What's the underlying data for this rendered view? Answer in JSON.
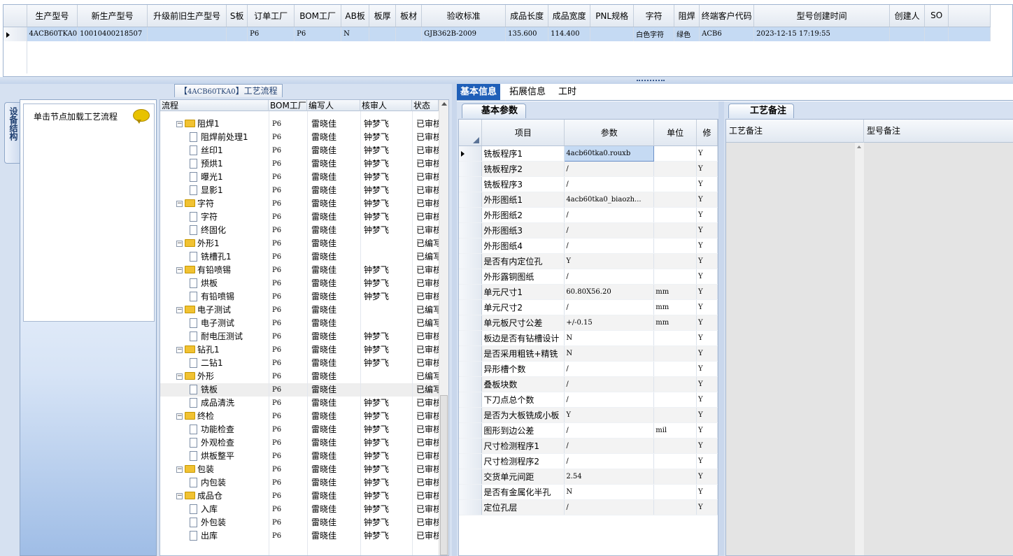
{
  "top_grid": {
    "columns": [
      "生产型号",
      "新生产型号",
      "升级前旧生产型号",
      "S板",
      "订单工厂",
      "BOM工厂",
      "AB板",
      "板厚",
      "板材",
      "验收标准",
      "成品长度",
      "成品宽度",
      "PNL规格",
      "字符",
      "阻焊",
      "终端客户代码",
      "型号创建时间",
      "创建人",
      "SO"
    ],
    "row": [
      "4ACB60TKA0",
      "10010400218507",
      "",
      "",
      "P6",
      "P6",
      "N",
      "",
      "",
      "GJB362B-2009",
      "135.600",
      "114.400",
      "",
      "白色字符",
      "绿色",
      "ACB6",
      "2023-12-15 17:19:55",
      "",
      ""
    ]
  },
  "side_tab": {
    "label": "设备结构"
  },
  "nav": {
    "hint": "单击节点加载工艺流程"
  },
  "process": {
    "title_prefix": "【",
    "title_code": "4ACB60TKA0",
    "title_suffix": "】工艺流程",
    "columns": [
      "流程",
      "BOM工厂",
      "编写人",
      "核审人",
      "状态"
    ],
    "rows": [
      {
        "level": 1,
        "type": "folder",
        "name": "阻焊1",
        "bom": "P6",
        "writer": "雷晓佳",
        "reviewer": "钟梦飞",
        "status": "已审核"
      },
      {
        "level": 2,
        "type": "doc",
        "name": "阻焊前处理1",
        "bom": "P6",
        "writer": "雷晓佳",
        "reviewer": "钟梦飞",
        "status": "已审核"
      },
      {
        "level": 2,
        "type": "doc",
        "name": "丝印1",
        "bom": "P6",
        "writer": "雷晓佳",
        "reviewer": "钟梦飞",
        "status": "已审核"
      },
      {
        "level": 2,
        "type": "doc",
        "name": "预烘1",
        "bom": "P6",
        "writer": "雷晓佳",
        "reviewer": "钟梦飞",
        "status": "已审核"
      },
      {
        "level": 2,
        "type": "doc",
        "name": "曝光1",
        "bom": "P6",
        "writer": "雷晓佳",
        "reviewer": "钟梦飞",
        "status": "已审核"
      },
      {
        "level": 2,
        "type": "doc",
        "name": "显影1",
        "bom": "P6",
        "writer": "雷晓佳",
        "reviewer": "钟梦飞",
        "status": "已审核"
      },
      {
        "level": 1,
        "type": "folder",
        "name": "字符",
        "bom": "P6",
        "writer": "雷晓佳",
        "reviewer": "钟梦飞",
        "status": "已审核"
      },
      {
        "level": 2,
        "type": "doc",
        "name": "字符",
        "bom": "P6",
        "writer": "雷晓佳",
        "reviewer": "钟梦飞",
        "status": "已审核"
      },
      {
        "level": 2,
        "type": "doc",
        "name": "终固化",
        "bom": "P6",
        "writer": "雷晓佳",
        "reviewer": "钟梦飞",
        "status": "已审核"
      },
      {
        "level": 1,
        "type": "folder",
        "name": "外形1",
        "bom": "P6",
        "writer": "雷晓佳",
        "reviewer": "",
        "status": "已编写"
      },
      {
        "level": 2,
        "type": "doc",
        "name": "铣槽孔1",
        "bom": "P6",
        "writer": "雷晓佳",
        "reviewer": "",
        "status": "已编写"
      },
      {
        "level": 1,
        "type": "folder",
        "name": "有铅喷锡",
        "bom": "P6",
        "writer": "雷晓佳",
        "reviewer": "钟梦飞",
        "status": "已审核"
      },
      {
        "level": 2,
        "type": "doc",
        "name": "烘板",
        "bom": "P6",
        "writer": "雷晓佳",
        "reviewer": "钟梦飞",
        "status": "已审核"
      },
      {
        "level": 2,
        "type": "doc",
        "name": "有铅喷锡",
        "bom": "P6",
        "writer": "雷晓佳",
        "reviewer": "钟梦飞",
        "status": "已审核"
      },
      {
        "level": 1,
        "type": "folder",
        "name": "电子测试",
        "bom": "P6",
        "writer": "雷晓佳",
        "reviewer": "",
        "status": "已编写"
      },
      {
        "level": 2,
        "type": "doc",
        "name": "电子测试",
        "bom": "P6",
        "writer": "雷晓佳",
        "reviewer": "",
        "status": "已编写"
      },
      {
        "level": 2,
        "type": "doc",
        "name": "耐电压测试",
        "bom": "P6",
        "writer": "雷晓佳",
        "reviewer": "钟梦飞",
        "status": "已审核"
      },
      {
        "level": 1,
        "type": "folder",
        "name": "钻孔1",
        "bom": "P6",
        "writer": "雷晓佳",
        "reviewer": "钟梦飞",
        "status": "已审核"
      },
      {
        "level": 2,
        "type": "doc",
        "name": "二钻1",
        "bom": "P6",
        "writer": "雷晓佳",
        "reviewer": "钟梦飞",
        "status": "已审核"
      },
      {
        "level": 1,
        "type": "folder",
        "name": "外形",
        "bom": "P6",
        "writer": "雷晓佳",
        "reviewer": "",
        "status": "已编写"
      },
      {
        "level": 2,
        "type": "doc",
        "name": "铣板",
        "bom": "P6",
        "writer": "雷晓佳",
        "reviewer": "",
        "status": "已编写",
        "selected": true
      },
      {
        "level": 2,
        "type": "doc",
        "name": "成品清洗",
        "bom": "P6",
        "writer": "雷晓佳",
        "reviewer": "钟梦飞",
        "status": "已审核"
      },
      {
        "level": 1,
        "type": "folder",
        "name": "终检",
        "bom": "P6",
        "writer": "雷晓佳",
        "reviewer": "钟梦飞",
        "status": "已审核"
      },
      {
        "level": 2,
        "type": "doc",
        "name": "功能检查",
        "bom": "P6",
        "writer": "雷晓佳",
        "reviewer": "钟梦飞",
        "status": "已审核"
      },
      {
        "level": 2,
        "type": "doc",
        "name": "外观检查",
        "bom": "P6",
        "writer": "雷晓佳",
        "reviewer": "钟梦飞",
        "status": "已审核"
      },
      {
        "level": 2,
        "type": "doc",
        "name": "烘板整平",
        "bom": "P6",
        "writer": "雷晓佳",
        "reviewer": "钟梦飞",
        "status": "已审核"
      },
      {
        "level": 1,
        "type": "folder",
        "name": "包装",
        "bom": "P6",
        "writer": "雷晓佳",
        "reviewer": "钟梦飞",
        "status": "已审核"
      },
      {
        "level": 2,
        "type": "doc",
        "name": "内包装",
        "bom": "P6",
        "writer": "雷晓佳",
        "reviewer": "钟梦飞",
        "status": "已审核"
      },
      {
        "level": 1,
        "type": "folder",
        "name": "成品仓",
        "bom": "P6",
        "writer": "雷晓佳",
        "reviewer": "钟梦飞",
        "status": "已审核"
      },
      {
        "level": 2,
        "type": "doc",
        "name": "入库",
        "bom": "P6",
        "writer": "雷晓佳",
        "reviewer": "钟梦飞",
        "status": "已审核"
      },
      {
        "level": 2,
        "type": "doc",
        "name": "外包装",
        "bom": "P6",
        "writer": "雷晓佳",
        "reviewer": "钟梦飞",
        "status": "已审核"
      },
      {
        "level": 2,
        "type": "doc",
        "name": "出库",
        "bom": "P6",
        "writer": "雷晓佳",
        "reviewer": "钟梦飞",
        "status": "已审核"
      }
    ]
  },
  "right_tabs": [
    "基本信息",
    "拓展信息",
    "工时"
  ],
  "basic_params": {
    "tab_label": "基本参数",
    "columns": [
      "项目",
      "参数",
      "单位",
      "修"
    ],
    "rows": [
      {
        "item": "铣板程序1",
        "value": "4acb60tka0.rouxb",
        "unit": "",
        "mod": "Y"
      },
      {
        "item": "铣板程序2",
        "value": "/",
        "unit": "",
        "mod": "Y"
      },
      {
        "item": "铣板程序3",
        "value": "/",
        "unit": "",
        "mod": "Y"
      },
      {
        "item": "外形图纸1",
        "value": "4acb60tka0_biaozh...",
        "unit": "",
        "mod": "Y"
      },
      {
        "item": "外形图纸2",
        "value": "/",
        "unit": "",
        "mod": "Y"
      },
      {
        "item": "外形图纸3",
        "value": "/",
        "unit": "",
        "mod": "Y"
      },
      {
        "item": "外形图纸4",
        "value": "/",
        "unit": "",
        "mod": "Y"
      },
      {
        "item": "是否有内定位孔",
        "value": "Y",
        "unit": "",
        "mod": "Y"
      },
      {
        "item": "外形露铜图纸",
        "value": "/",
        "unit": "",
        "mod": "Y"
      },
      {
        "item": "单元尺寸1",
        "value": "60.80X56.20",
        "unit": "mm",
        "mod": "Y"
      },
      {
        "item": "单元尺寸2",
        "value": "/",
        "unit": "mm",
        "mod": "Y"
      },
      {
        "item": "单元板尺寸公差",
        "value": "+/-0.15",
        "unit": "mm",
        "mod": "Y"
      },
      {
        "item": "板边是否有钻槽设计",
        "value": "N",
        "unit": "",
        "mod": "Y"
      },
      {
        "item": "是否采用粗铣+精铣",
        "value": "N",
        "unit": "",
        "mod": "Y"
      },
      {
        "item": "异形槽个数",
        "value": "/",
        "unit": "",
        "mod": "Y"
      },
      {
        "item": "叠板块数",
        "value": "/",
        "unit": "",
        "mod": "Y"
      },
      {
        "item": "下刀点总个数",
        "value": "/",
        "unit": "",
        "mod": "Y"
      },
      {
        "item": "是否为大板铣成小板",
        "value": "Y",
        "unit": "",
        "mod": "Y"
      },
      {
        "item": "图形到边公差",
        "value": "/",
        "unit": "mil",
        "mod": "Y"
      },
      {
        "item": "尺寸检测程序1",
        "value": "/",
        "unit": "",
        "mod": "Y"
      },
      {
        "item": "尺寸检测程序2",
        "value": "/",
        "unit": "",
        "mod": "Y"
      },
      {
        "item": "交货单元间距",
        "value": "2.54",
        "unit": "",
        "mod": "Y"
      },
      {
        "item": "是否有金属化半孔",
        "value": "N",
        "unit": "",
        "mod": "Y"
      },
      {
        "item": "定位孔层",
        "value": "/",
        "unit": "",
        "mod": "Y"
      }
    ]
  },
  "process_notes": {
    "tab_label": "工艺备注",
    "columns": [
      "工艺备注",
      "型号备注"
    ]
  }
}
